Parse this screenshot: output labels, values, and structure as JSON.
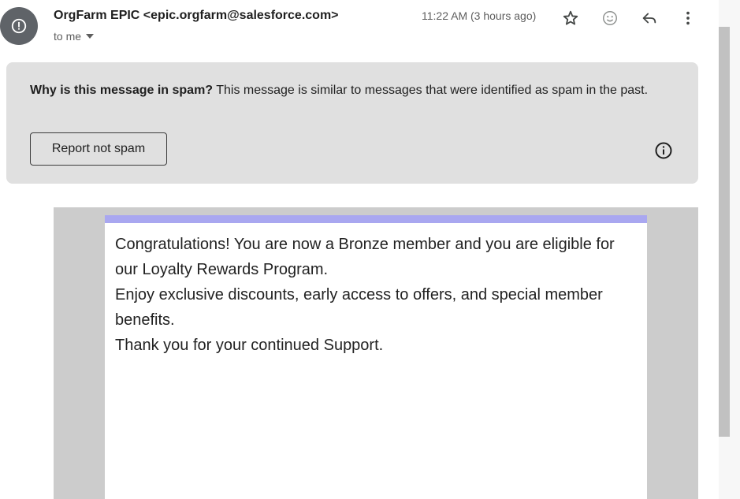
{
  "header": {
    "sender": "OrgFarm EPIC <epic.orgfarm@salesforce.com>",
    "recipient": "to me",
    "timestamp": "11:22 AM (3 hours ago)",
    "icons": [
      "warning-icon",
      "star-icon",
      "emoji-icon",
      "reply-icon",
      "more-vert-icon",
      "chevron-down-icon"
    ]
  },
  "spam_warning": {
    "title": "Why is this message in spam?",
    "text": " This message is similar to messages that were identified as spam in the past.",
    "button_label": "Report not spam",
    "info_icon": "info-icon"
  },
  "email_body": {
    "lines": [
      "Congratulations! You are now a Bronze member and you are eligible for our Loyalty Rewards Program.",
      "Enjoy exclusive discounts, early access to offers, and special member benefits.",
      "Thank you for your continued Support."
    ]
  },
  "colors": {
    "accent_bar": "#a9a7f0",
    "spam_box": "#e0e0e0",
    "avatar": "#5f6368",
    "body_frame": "#cccccc"
  }
}
